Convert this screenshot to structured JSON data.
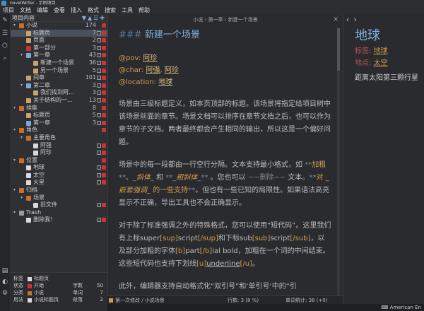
{
  "window": {
    "title": "novelWriter - 示例项目"
  },
  "menu": [
    "项目",
    "文档",
    "编辑",
    "查看",
    "插入",
    "格式",
    "搜索",
    "工具",
    "帮助"
  ],
  "tree": {
    "header": "项目内容",
    "rows": [
      {
        "indent": 0,
        "arrow": "▾",
        "icon": "#c86f2c",
        "label": "小说",
        "count": "174",
        "check": false,
        "status": "#cc3333",
        "sel": false
      },
      {
        "indent": 1,
        "arrow": "",
        "icon": "#c9a36a",
        "label": "标题页",
        "count": "7",
        "check": true,
        "status": "#cc3333",
        "sel": true
      },
      {
        "indent": 1,
        "arrow": "",
        "icon": "#c9a36a",
        "label": "页面",
        "count": "2",
        "check": true,
        "status": "#cc3333",
        "sel": false
      },
      {
        "indent": 1,
        "arrow": "",
        "icon": "#cc3333",
        "label": "第一部分",
        "count": "3",
        "check": true,
        "status": "#cc3333",
        "sel": false
      },
      {
        "indent": 1,
        "arrow": "▾",
        "icon": "#7fa6d6",
        "label": "第一章",
        "count": "43",
        "check": true,
        "status": "#cc3333",
        "sel": false
      },
      {
        "indent": 2,
        "arrow": "",
        "icon": "#c9a36a",
        "label": "新建一个场景",
        "count": "36",
        "check": true,
        "status": "#cc3333",
        "sel": false
      },
      {
        "indent": 2,
        "arrow": "",
        "icon": "#c9a36a",
        "label": "另一个场景",
        "count": "5",
        "check": true,
        "status": "#cc3333",
        "sel": false
      },
      {
        "indent": 1,
        "arrow": "",
        "icon": "#c9a36a",
        "label": "间章",
        "count": "101",
        "check": true,
        "status": "#cc3333",
        "sel": false
      },
      {
        "indent": 1,
        "arrow": "▾",
        "icon": "#7fa6d6",
        "label": "第二章",
        "count": "3",
        "check": true,
        "status": "#cc3333",
        "sel": false
      },
      {
        "indent": 2,
        "arrow": "",
        "icon": "#c9a36a",
        "label": "我们找到阿...",
        "count": "3",
        "check": true,
        "status": "#cc3333",
        "sel": false
      },
      {
        "indent": 1,
        "arrow": "",
        "icon": "#c9a36a",
        "label": "关于结构的一...",
        "count": "13",
        "check": true,
        "status": "#cc3333",
        "sel": false
      },
      {
        "indent": 0,
        "arrow": "▾",
        "icon": "#c86f2c",
        "label": "续集",
        "count": "8",
        "check": false,
        "status": "#cc3333",
        "sel": false
      },
      {
        "indent": 1,
        "arrow": "",
        "icon": "#c9a36a",
        "label": "标题页",
        "count": "5",
        "check": true,
        "status": "#cc3333",
        "sel": false
      },
      {
        "indent": 1,
        "arrow": "",
        "icon": "#7fa6d6",
        "label": "第一章",
        "count": "3",
        "check": true,
        "status": "#cc3333",
        "sel": false
      },
      {
        "indent": 0,
        "arrow": "▾",
        "icon": "#c86f2c",
        "label": "角色",
        "count": "",
        "check": false,
        "status": "#cc3333",
        "sel": false
      },
      {
        "indent": 1,
        "arrow": "▾",
        "icon": "#c86f2c",
        "label": "主要角色",
        "count": "",
        "check": false,
        "status": "",
        "sel": false
      },
      {
        "indent": 2,
        "arrow": "",
        "icon": "#d9d9d9",
        "label": "阿强",
        "count": "",
        "check": true,
        "status": "#cc3333",
        "sel": false
      },
      {
        "indent": 2,
        "arrow": "",
        "icon": "#d9d9d9",
        "label": "阿珍",
        "count": "",
        "check": true,
        "status": "#cc3333",
        "sel": false
      },
      {
        "indent": 0,
        "arrow": "▾",
        "icon": "#c86f2c",
        "label": "位置",
        "count": "",
        "check": false,
        "status": "#cc3333",
        "sel": false
      },
      {
        "indent": 1,
        "arrow": "",
        "icon": "#d9d9d9",
        "label": "地球",
        "count": "",
        "check": true,
        "status": "#cc3333",
        "sel": false
      },
      {
        "indent": 1,
        "arrow": "",
        "icon": "#d9d9d9",
        "label": "太空",
        "count": "",
        "check": true,
        "status": "#cc3333",
        "sel": false
      },
      {
        "indent": 1,
        "arrow": "",
        "icon": "#d9d9d9",
        "label": "火星",
        "count": "",
        "check": true,
        "status": "#cc3333",
        "sel": false
      },
      {
        "indent": 0,
        "arrow": "▾",
        "icon": "#c86f2c",
        "label": "归档",
        "count": "",
        "check": false,
        "status": "",
        "sel": false
      },
      {
        "indent": 1,
        "arrow": "▾",
        "icon": "#c86f2c",
        "label": "场景",
        "count": "",
        "check": false,
        "status": "",
        "sel": false
      },
      {
        "indent": 2,
        "arrow": "",
        "icon": "#d9d9d9",
        "label": "旧文件",
        "count": "",
        "check": true,
        "status": "#cc3333",
        "sel": false
      },
      {
        "indent": 0,
        "arrow": "▾",
        "icon": "#999999",
        "label": "Trash",
        "count": "",
        "check": false,
        "status": "",
        "sel": false
      },
      {
        "indent": 1,
        "arrow": "",
        "icon": "#d9d9d9",
        "label": "删除我！",
        "count": "",
        "check": true,
        "status": "#cc3333",
        "sel": false
      }
    ]
  },
  "footer": {
    "rows": [
      {
        "k": "标签",
        "icon": "#d9d9d9",
        "v": "标题页"
      },
      {
        "k": "状态",
        "icon": "#cc3333",
        "v": "开始"
      },
      {
        "k": "分类",
        "icon": "#c86f2c",
        "v": "小说"
      },
      {
        "k": "用法",
        "icon": "#d9d9d9",
        "v": "小说标题页"
      }
    ],
    "stats": [
      {
        "k": "字数",
        "v": "50"
      },
      {
        "k": "单词",
        "v": "7"
      },
      {
        "k": "段落",
        "v": "2"
      }
    ]
  },
  "editor": {
    "breadcrumb": "小说  ›  第一章  ›  新建一个场景",
    "heading_marker": "###",
    "heading": "新建一个场景",
    "meta": [
      {
        "key": "@pov:",
        "vals": [
          "阿珍"
        ]
      },
      {
        "key": "@char:",
        "vals": [
          "阿强",
          "阿珍"
        ]
      },
      {
        "key": "@location:",
        "vals": [
          "地球"
        ]
      }
    ],
    "p1": "场景由三级标题定义，如本页顶部的标题。该场景将指定给项目树中该场景前面的章节。场景文档可以排序在章节文档之后，也可以作为章节的子文档。两者最终都会产生相同的输出，所以这是一个偏好问题。",
    "p2": {
      "a": "场景中的每一段都由一行空行分隔。文本支持最小格式，如 ",
      "bold_mk": "**",
      "bold": "加粗",
      "c": "、",
      "it_mk": "_",
      "it": "斜体",
      "d": " 和 ",
      "bi_mk1": "**_",
      "bi": "粗斜体",
      "bi_mk2": "_**",
      "e": " 。您也可以 ",
      "st_mk": "~~",
      "st": "删",
      "st2": "除",
      "st_mk2": "~~",
      "f": " 文本。",
      "g_mk": "**",
      "g1": "对 ",
      "g2": "_嵌套强调_",
      "g3": " 的一些支持",
      "h": "。但也有一些已知的局限性。如果语法高亮显示不正确，导出工具也不会正确显示。"
    },
    "p3": {
      "a": "对于除了标准强调之外的特殊格式，您可以使用“短代码”。这里我们有上标super",
      "sup1": "[sup]",
      "sup": "script",
      "sup2": "[/sup]",
      "b": "和下标sub",
      "sub1": "[sub]",
      "sub": "script",
      "sub2": "[/sub]",
      "c": "，以及部分加粗的字体",
      "b1": "[b]",
      "bb": "part",
      "b2": "[/b]",
      "d": "ial bold，加粗在一个词的中间结束。这些短代码也支持下划线",
      "u1": "[u]",
      "uu": "underline",
      "u2": "[/u]",
      "e": "。"
    },
    "p4": "此外，编辑器支持自动格式化“双引号”和‘单引号’中的“引"
  },
  "status": {
    "left": "第一次修改 / 小说场景",
    "lines": "行数: 3 (8 %)",
    "words": "单词统计: 36 (+0)"
  },
  "viewer": {
    "title": "地球",
    "tag_key": "标签:",
    "tag_val": "地球",
    "loc_key": "地点:",
    "loc_val": "太空",
    "text": "距离太阳第三颗行星"
  },
  "locale": "American En"
}
